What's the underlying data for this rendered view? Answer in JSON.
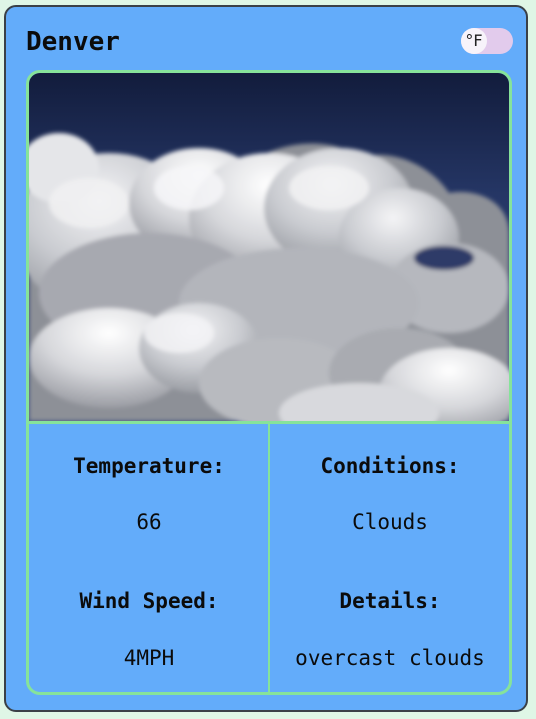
{
  "city": "Denver",
  "unit_toggle": {
    "label": "°F",
    "icon": "temperature-unit-toggle"
  },
  "weather_image": {
    "icon": "cloudy-sky-photo"
  },
  "stats": {
    "temperature": {
      "label": "Temperature:",
      "value": "66"
    },
    "conditions": {
      "label": "Conditions:",
      "value": "Clouds"
    },
    "wind_speed": {
      "label": "Wind Speed:",
      "value": "4MPH"
    },
    "details": {
      "label": "Details:",
      "value": "overcast clouds"
    }
  },
  "colors": {
    "card_background": "#63acfa",
    "panel_border": "#86e39a",
    "toggle_track": "#e2cbec",
    "sky_top": "#1d2f5e"
  }
}
